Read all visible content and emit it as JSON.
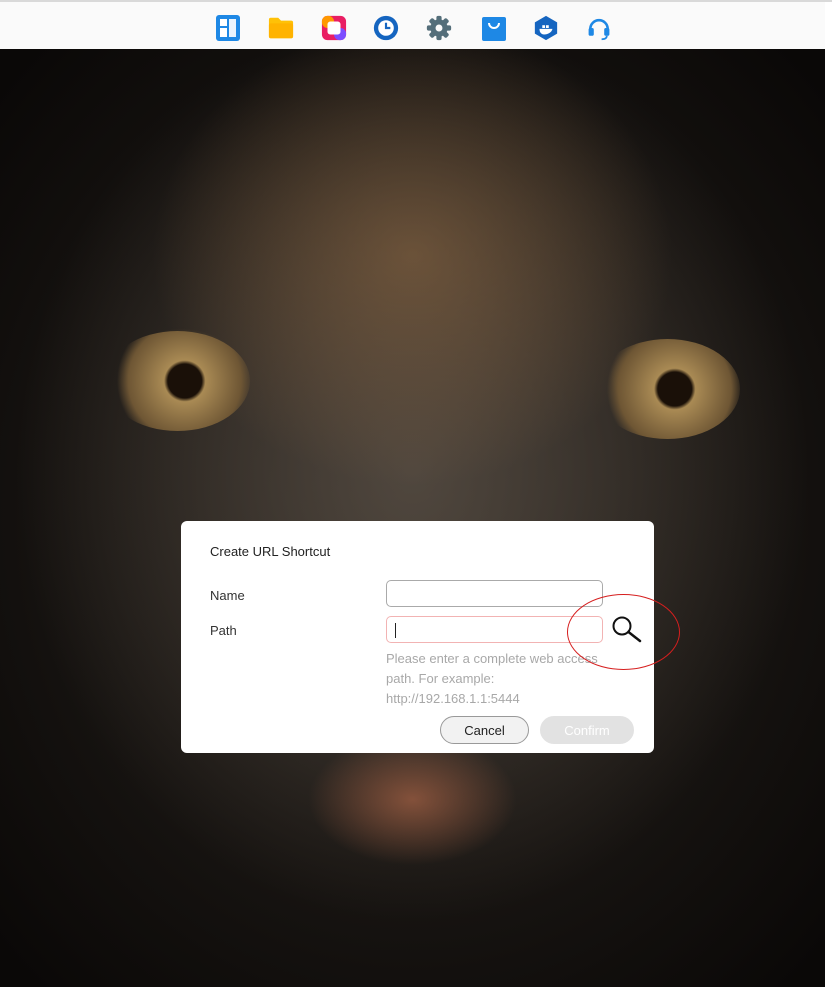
{
  "dock": {
    "icons": [
      "dashboard-icon",
      "files-icon",
      "photos-icon",
      "backup-clock-icon",
      "settings-gear-icon",
      "app-store-icon",
      "docker-icon",
      "support-headset-icon"
    ]
  },
  "dialog": {
    "title": "Create URL Shortcut",
    "name_label": "Name",
    "name_value": "",
    "path_label": "Path",
    "path_value": "",
    "hint": "Please enter a complete web access path. For example: http://192.168.1.1:5444",
    "cancel_label": "Cancel",
    "confirm_label": "Confirm"
  },
  "colors": {
    "accent_blue": "#1e88e5",
    "folder_yellow": "#ffc107",
    "error_border": "#f2b3b3",
    "annotation_red": "#d61f1f"
  }
}
